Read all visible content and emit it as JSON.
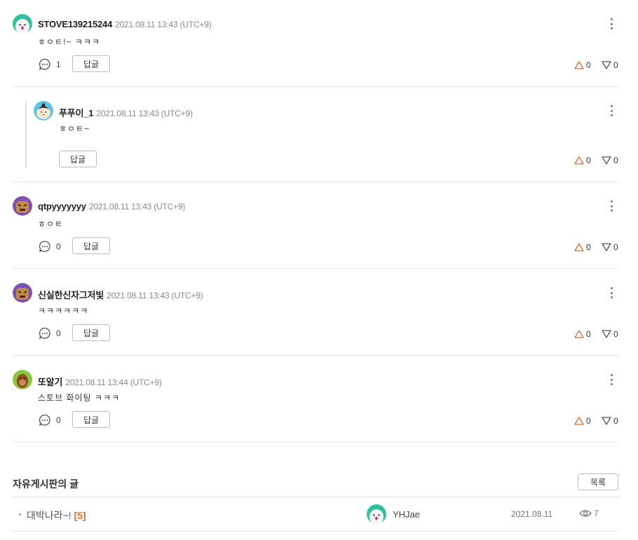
{
  "comments": [
    {
      "user": "STOVE139215244",
      "time": "2021.08.11 13:43 (UTC+9)",
      "text": "ㅎㅇㅌ!~ ㅋㅋㅋ",
      "reply_count": "1",
      "reply_label": "답글",
      "up": "0",
      "down": "0",
      "avatar": "white-ghost"
    },
    {
      "user": "푸푸이_1",
      "time": "2021.08.11 13:43 (UTC+9)",
      "text": "ㅎㅇㅌ~",
      "reply_label": "답글",
      "up": "0",
      "down": "0",
      "avatar": "girl-face"
    },
    {
      "user": "qtpyyyyyyy",
      "time": "2021.08.11 13:43 (UTC+9)",
      "text": "ㅎㅇㅌ",
      "reply_count": "0",
      "reply_label": "답글",
      "up": "0",
      "down": "0",
      "avatar": "purple-angry"
    },
    {
      "user": "신실한신자그저빛",
      "time": "2021.08.11 13:43 (UTC+9)",
      "text": "ㅋㅋㅋㅋㅋㅋ",
      "reply_count": "0",
      "reply_label": "답글",
      "up": "0",
      "down": "0",
      "avatar": "purple-angry"
    },
    {
      "user": "또알기",
      "time": "2021.08.11 13:44 (UTC+9)",
      "text": "스토브 화이팅 ㅋㅋㅋ",
      "reply_count": "0",
      "reply_label": "답글",
      "up": "0",
      "down": "0",
      "avatar": "green-monkey"
    }
  ],
  "board": {
    "title": "자유게시판의 글",
    "list_label": "목록",
    "posts": [
      {
        "title": "대박나라~!",
        "count": "[5]",
        "author": "YHJae",
        "date": "2021.08.11",
        "views": "7",
        "avatar": "white-ghost"
      }
    ]
  },
  "colors": {
    "up_icon": "#e36a2a",
    "down_icon": "#555555",
    "comment_count_accent": "#e36a2a"
  }
}
